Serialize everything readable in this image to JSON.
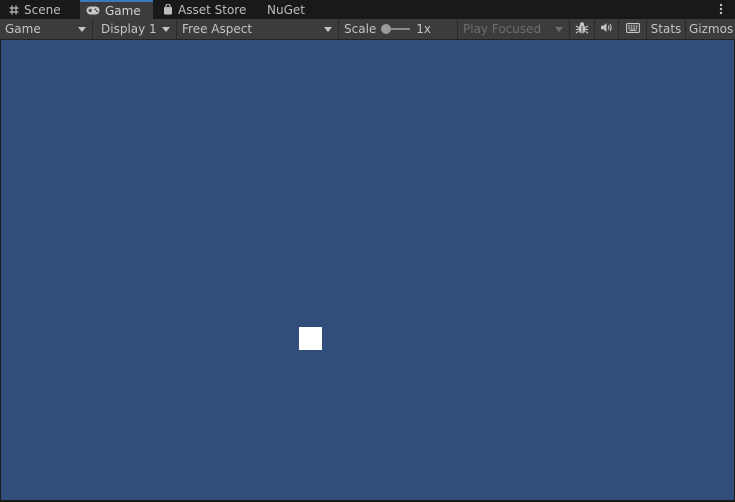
{
  "tabs": [
    {
      "label": "Scene",
      "icon": "hash-grid-icon",
      "active": false
    },
    {
      "label": "Game",
      "icon": "gamepad-icon",
      "active": true
    },
    {
      "label": "Asset Store",
      "icon": "shopping-bag-icon",
      "active": false
    },
    {
      "label": "NuGet",
      "icon": "",
      "active": false
    }
  ],
  "toolbar": {
    "mode_label": "Game",
    "display_label": "Display 1",
    "aspect_label": "Free Aspect",
    "scale_label": "Scale",
    "scale_value": "1x",
    "play_label": "Play Focused",
    "stats_label": "Stats",
    "gizmos_label": "Gizmos"
  },
  "icons": {
    "debug": "bug-icon",
    "audio": "speaker-icon",
    "shortcuts": "keyboard-icon",
    "menu": "kebab-menu-icon"
  },
  "colors": {
    "accent": "#3a79bb",
    "viewport_background": "#314d79",
    "game_object": "#ffffff",
    "toolbar": "#3c3c3c"
  }
}
